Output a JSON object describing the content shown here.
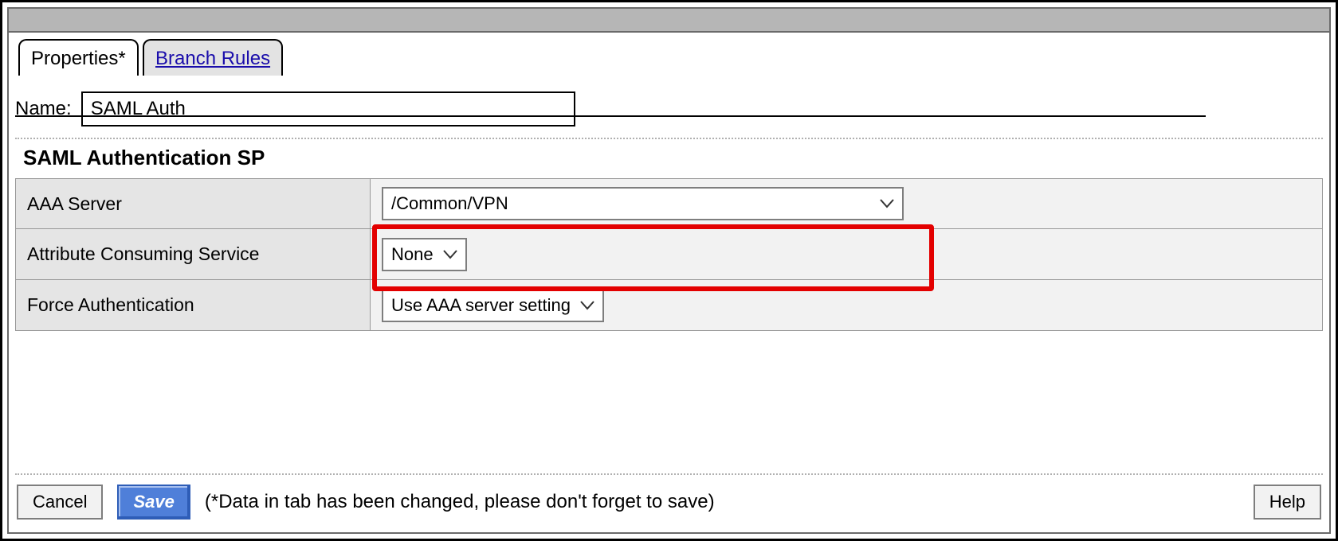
{
  "tabs": {
    "properties": "Properties*",
    "branch_rules": "Branch Rules"
  },
  "name_label": "Name:",
  "name_value": "SAML Auth",
  "section_title": "SAML Authentication SP",
  "fields": {
    "aaa_server": {
      "label": "AAA Server",
      "value": "/Common/VPN"
    },
    "acs": {
      "label": "Attribute Consuming Service",
      "value": "None"
    },
    "force_auth": {
      "label": "Force Authentication",
      "value": "Use AAA server setting"
    }
  },
  "footer": {
    "cancel": "Cancel",
    "save": "Save",
    "note": "(*Data in tab has been changed, please don't forget to save)",
    "help": "Help"
  }
}
